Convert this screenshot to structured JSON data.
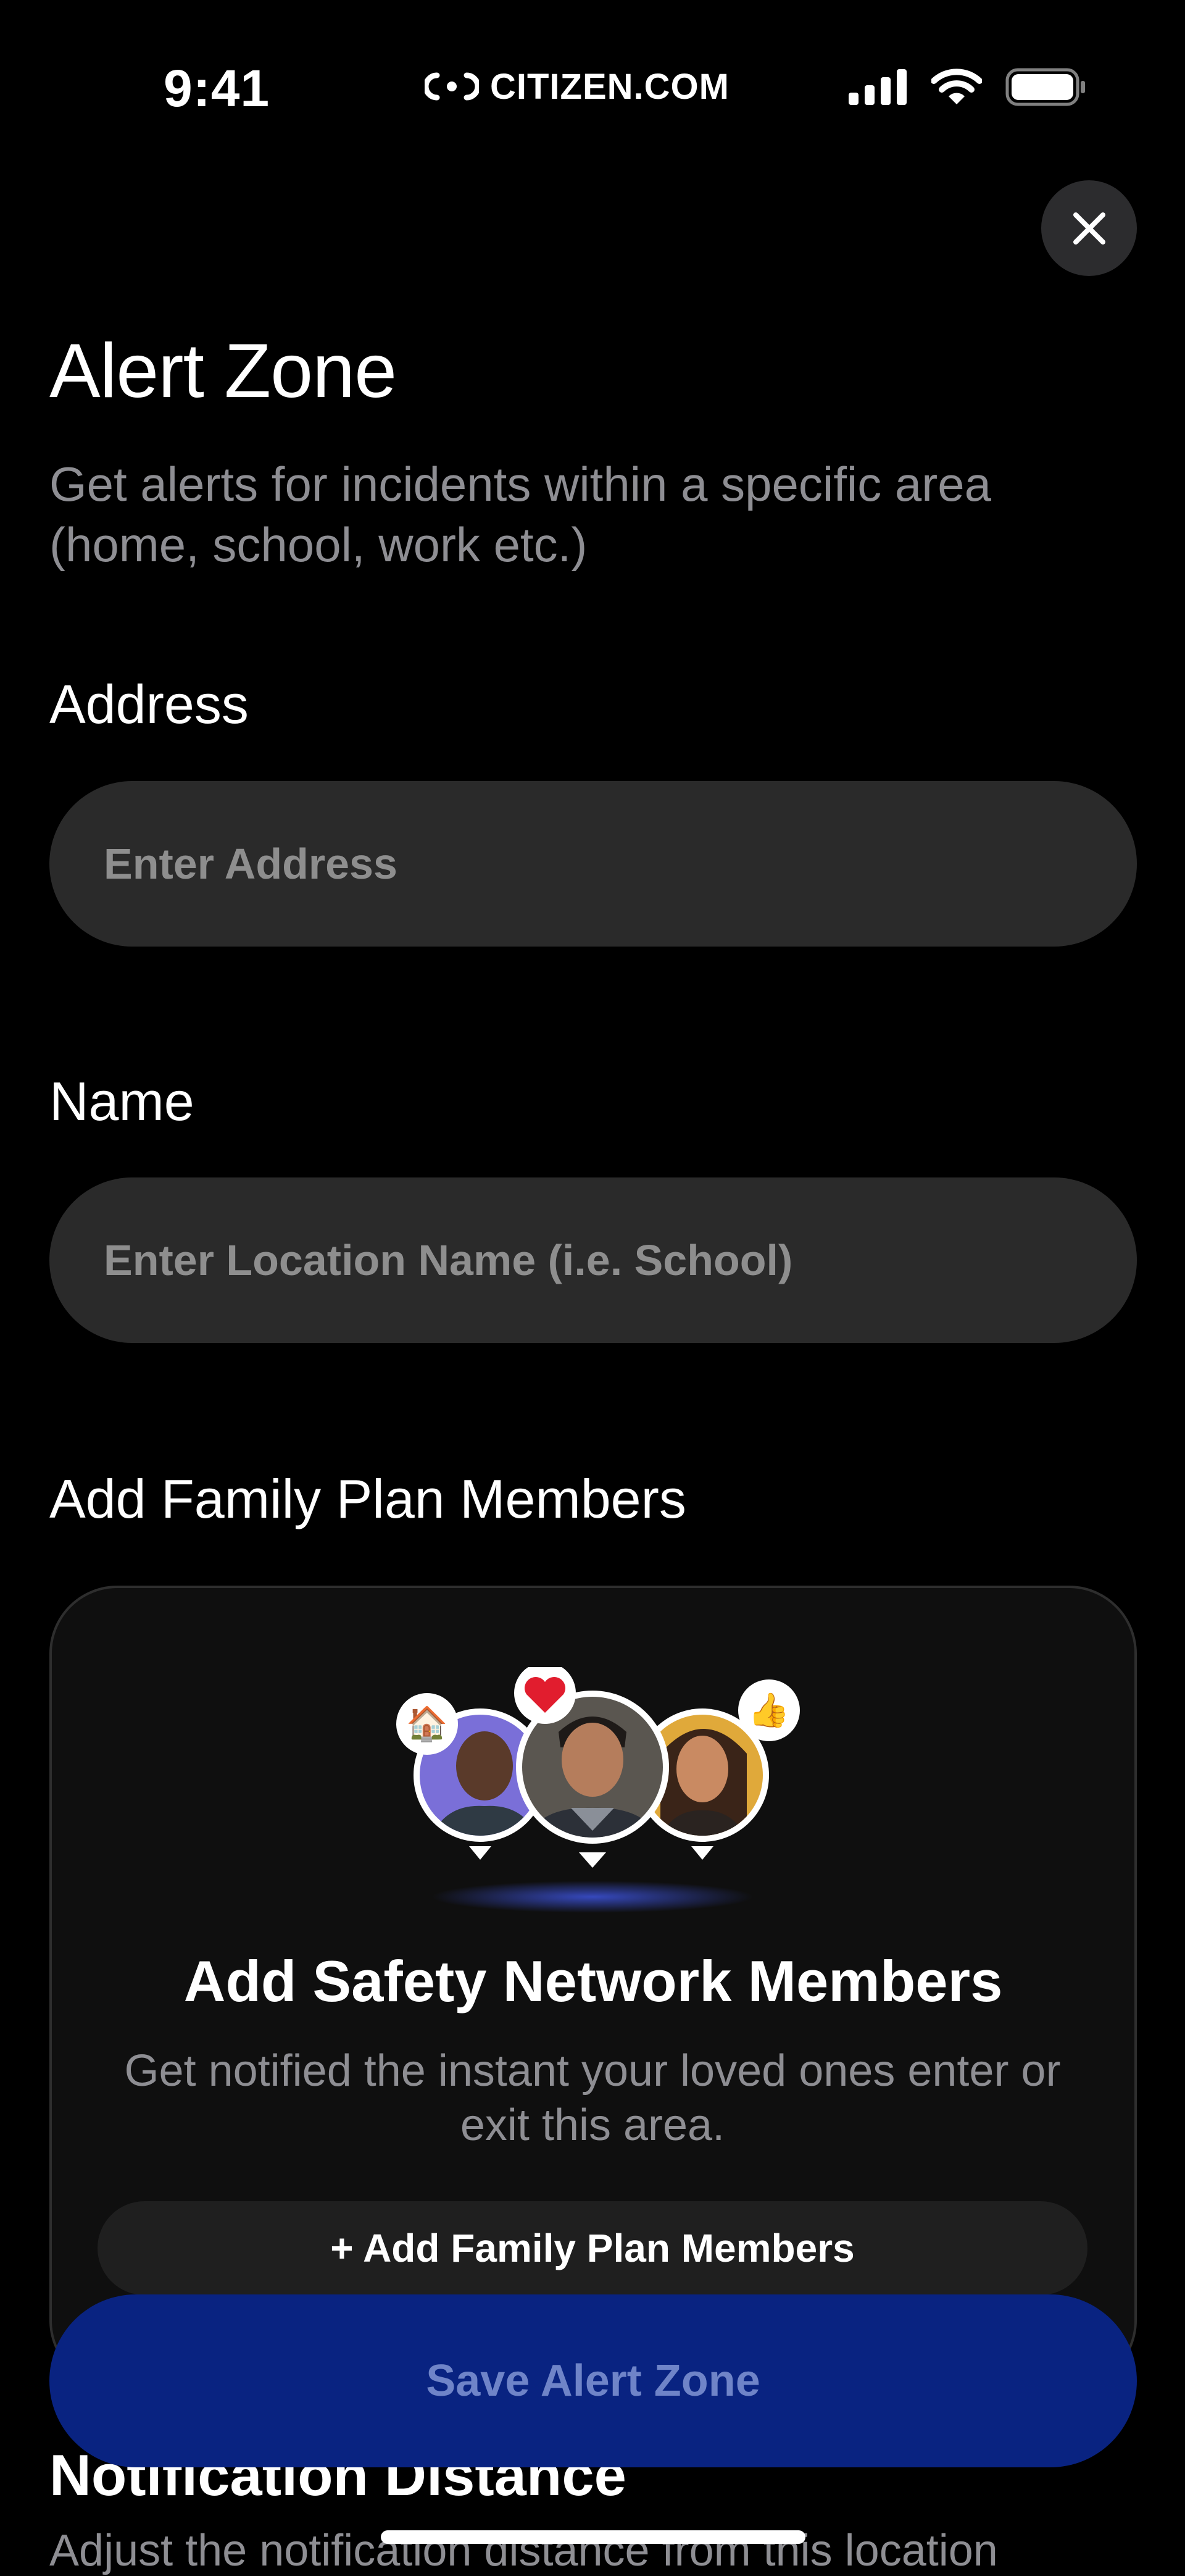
{
  "status_bar": {
    "time": "9:41",
    "brand": "CITIZEN.COM",
    "icons": [
      "signal-icon",
      "wifi-icon",
      "battery-icon"
    ]
  },
  "header": {
    "title": "Alert Zone",
    "subtitle": "Get alerts for incidents within a specific area (home, school, work etc.)",
    "close_icon": "close-icon"
  },
  "address": {
    "label": "Address",
    "placeholder": "Enter Address",
    "value": ""
  },
  "name": {
    "label": "Name",
    "placeholder": "Enter Location Name (i.e. School)",
    "value": ""
  },
  "family": {
    "label": "Add Family Plan Members",
    "card_title": "Add Safety Network Members",
    "card_description": "Get notified the instant your loved ones enter or exit this area.",
    "button_label": "+ Add Family Plan Members",
    "badges": [
      "house-emoji",
      "heart-emoji",
      "thumbs-up-emoji"
    ]
  },
  "notification": {
    "label": "Notification Distance",
    "description": "Adjust the notification distance from this location"
  },
  "save_button": {
    "label": "Save Alert Zone"
  },
  "colors": {
    "background": "#000000",
    "input_bg": "#2a2a2a",
    "muted_text": "#8e8e93",
    "save_button_bg": "#092381",
    "save_button_text": "#6f84c8"
  }
}
